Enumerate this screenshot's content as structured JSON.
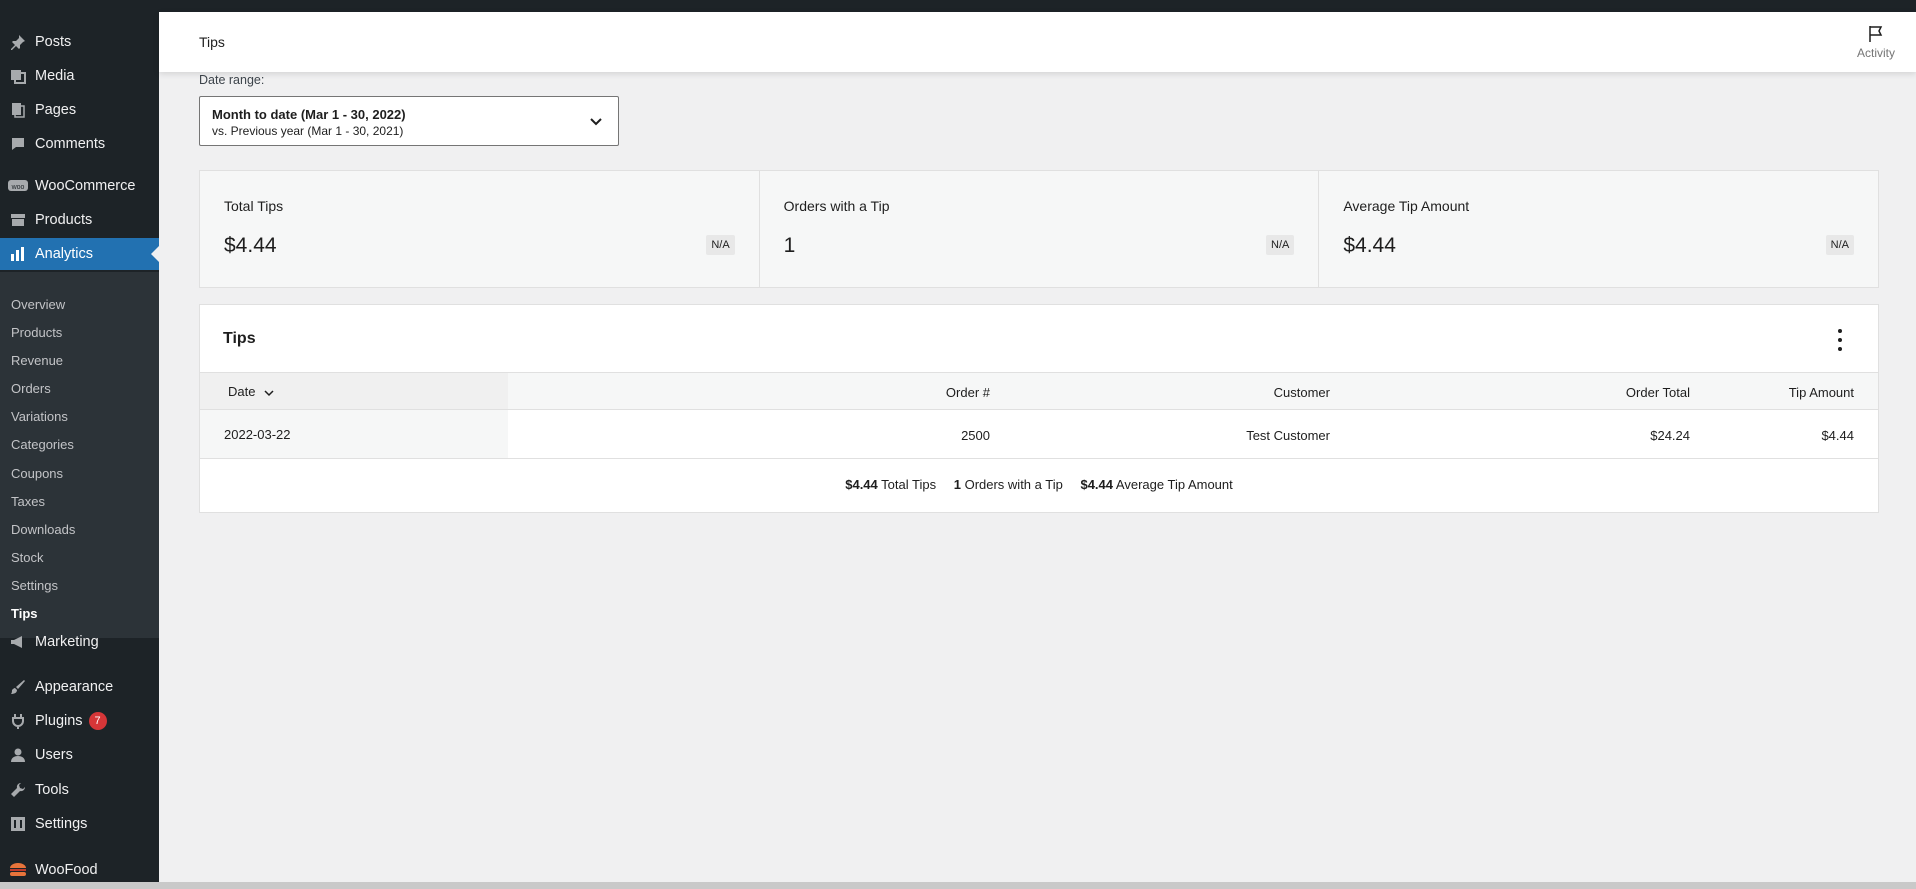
{
  "sidebar": {
    "top_items": [
      {
        "label": "Posts",
        "icon": "pushpin-icon"
      },
      {
        "label": "Media",
        "icon": "media-icon"
      },
      {
        "label": "Pages",
        "icon": "pages-icon"
      },
      {
        "label": "Comments",
        "icon": "comment-icon"
      },
      {
        "label": "WooCommerce",
        "icon": "woo-icon"
      },
      {
        "label": "Products",
        "icon": "archive-icon"
      },
      {
        "label": "Analytics",
        "icon": "bar-chart-icon"
      }
    ],
    "analytics_submenu": [
      "Overview",
      "Products",
      "Revenue",
      "Orders",
      "Variations",
      "Categories",
      "Coupons",
      "Taxes",
      "Downloads",
      "Stock",
      "Settings",
      "Tips"
    ],
    "bottom_items": [
      {
        "label": "Marketing",
        "icon": "megaphone-icon"
      },
      {
        "label": "Appearance",
        "icon": "brush-icon"
      },
      {
        "label": "Plugins",
        "icon": "plugin-icon",
        "badge": "7"
      },
      {
        "label": "Users",
        "icon": "user-icon"
      },
      {
        "label": "Tools",
        "icon": "wrench-icon"
      },
      {
        "label": "Settings",
        "icon": "settings-icon"
      },
      {
        "label": "WooFood",
        "icon": "burger-icon"
      }
    ]
  },
  "header": {
    "title": "Tips",
    "activity_label": "Activity"
  },
  "date_range": {
    "label": "Date range:",
    "primary": "Month to date (Mar 1 - 30, 2022)",
    "secondary": "vs. Previous year (Mar 1 - 30, 2021)"
  },
  "summary": [
    {
      "label": "Total Tips",
      "value": "$4.44",
      "delta": "N/A"
    },
    {
      "label": "Orders with a Tip",
      "value": "1",
      "delta": "N/A"
    },
    {
      "label": "Average Tip Amount",
      "value": "$4.44",
      "delta": "N/A"
    }
  ],
  "table": {
    "title": "Tips",
    "columns": [
      "Date",
      "Order #",
      "Customer",
      "Order Total",
      "Tip Amount"
    ],
    "rows": [
      {
        "date": "2022-03-22",
        "order": "2500",
        "customer": "Test Customer",
        "order_total": "$24.24",
        "tip_amount": "$4.44"
      }
    ],
    "footer": {
      "total_tips_value": "$4.44",
      "total_tips_label": "Total Tips",
      "orders_value": "1",
      "orders_label": "Orders with a Tip",
      "avg_value": "$4.44",
      "avg_label": "Average Tip Amount"
    }
  },
  "colors": {
    "sidebar": "#1d2327",
    "accent": "#2271b1",
    "badge": "#d63638"
  }
}
